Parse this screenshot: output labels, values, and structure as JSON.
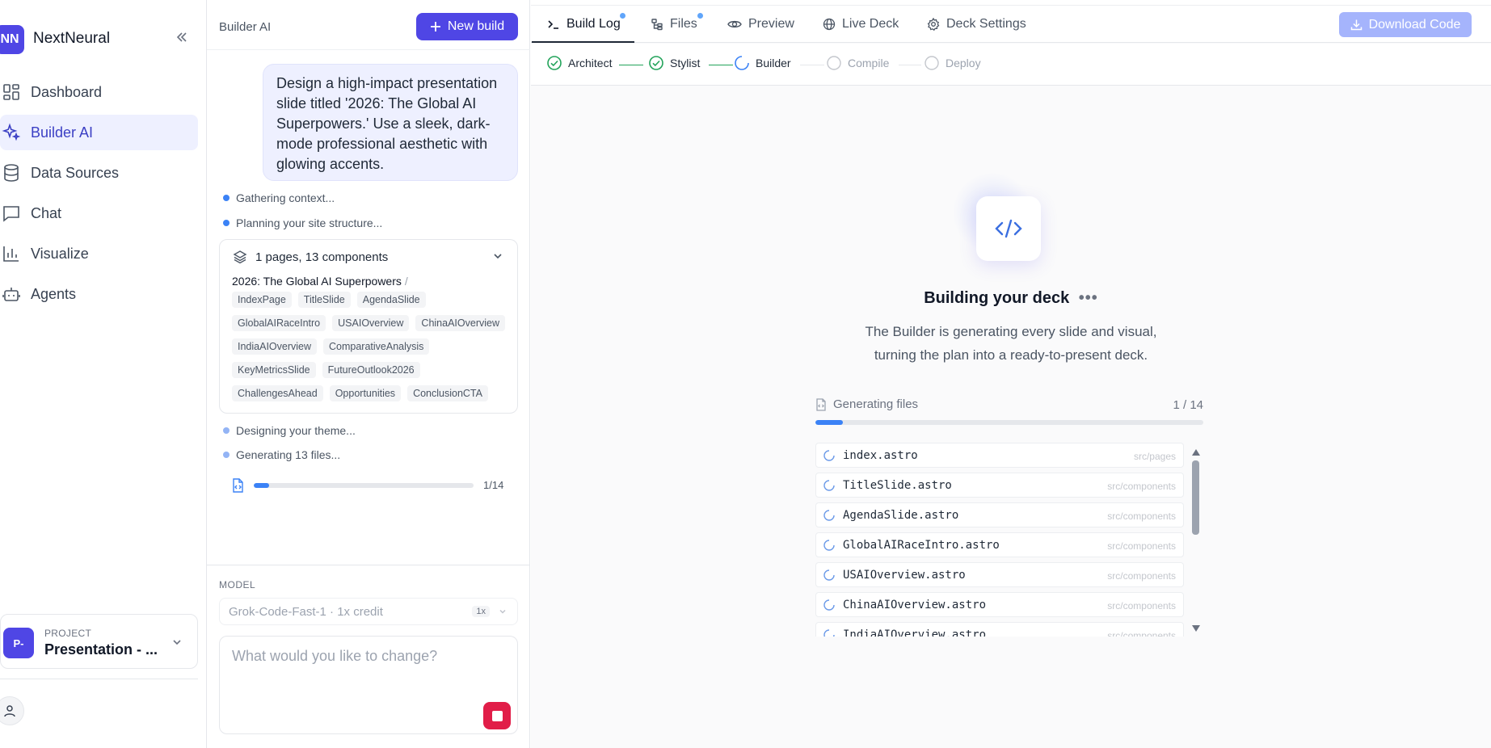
{
  "nav": {
    "logo": "NN",
    "brand": "NextNeural",
    "items": [
      {
        "label": "Dashboard",
        "icon": "dashboard-icon"
      },
      {
        "label": "Builder AI",
        "icon": "sparkles-icon",
        "active": true
      },
      {
        "label": "Data Sources",
        "icon": "database-icon"
      },
      {
        "label": "Chat",
        "icon": "chat-icon"
      },
      {
        "label": "Visualize",
        "icon": "bar-chart-icon"
      },
      {
        "label": "Agents",
        "icon": "bot-icon"
      }
    ],
    "project": {
      "avatar": "P-",
      "label": "PROJECT",
      "name": "Presentation - ..."
    }
  },
  "builder": {
    "title": "Builder AI",
    "new_build_label": "New build",
    "message": "Design a high-impact presentation slide titled '2026: The Global AI Superpowers.' Use a sleek, dark-mode professional aesthetic with glowing accents.",
    "steps": [
      "Gathering context...",
      "Planning your site structure...",
      "Designing your theme...",
      "Generating 13 files..."
    ],
    "structure": {
      "summary": "1 pages, 13 components",
      "page": "2026: The Global AI Superpowers",
      "separator": "/",
      "components": [
        "IndexPage",
        "TitleSlide",
        "AgendaSlide",
        "GlobalAIRaceIntro",
        "USAIOverview",
        "ChinaAIOverview",
        "IndiaAIOverview",
        "ComparativeAnalysis",
        "KeyMetricsSlide",
        "FutureOutlook2026",
        "ChallengesAhead",
        "Opportunities",
        "ConclusionCTA"
      ]
    },
    "progress": {
      "count": "1/14",
      "fraction": 0.0714
    },
    "model_label": "MODEL",
    "model_value": "Grok-Code-Fast-1 · 1x credit",
    "model_badge": "1x",
    "prompt_placeholder": "What would you like to change?"
  },
  "main": {
    "tabs": [
      {
        "label": "Build Log",
        "icon": "terminal-icon",
        "active": true,
        "dot": true
      },
      {
        "label": "Files",
        "icon": "file-tree-icon",
        "dot": true
      },
      {
        "label": "Preview",
        "icon": "eye-icon"
      },
      {
        "label": "Live Deck",
        "icon": "globe-icon"
      },
      {
        "label": "Deck Settings",
        "icon": "gear-icon"
      }
    ],
    "download_label": "Download Code",
    "pipeline": [
      {
        "label": "Architect",
        "status": "done"
      },
      {
        "label": "Stylist",
        "status": "done"
      },
      {
        "label": "Builder",
        "status": "active"
      },
      {
        "label": "Compile",
        "status": "pending"
      },
      {
        "label": "Deploy",
        "status": "pending"
      }
    ],
    "building_title": "Building your deck",
    "building_sub": "The Builder is generating every slide and visual, turning the plan into a ready-to-present deck.",
    "generating_label": "Generating files",
    "generating_count": "1 / 14",
    "generating_fraction": 0.0714,
    "files": [
      {
        "name": "index.astro",
        "path": "src/pages"
      },
      {
        "name": "TitleSlide.astro",
        "path": "src/components"
      },
      {
        "name": "AgendaSlide.astro",
        "path": "src/components"
      },
      {
        "name": "GlobalAIRaceIntro.astro",
        "path": "src/components"
      },
      {
        "name": "USAIOverview.astro",
        "path": "src/components"
      },
      {
        "name": "ChinaAIOverview.astro",
        "path": "src/components"
      },
      {
        "name": "IndiaAIOverview.astro",
        "path": "src/components"
      }
    ]
  },
  "colors": {
    "accent": "#4f46e5",
    "progress": "#3b82f6",
    "done": "#22a35a",
    "stop": "#e11d48",
    "download_disabled": "#a5b4fc"
  }
}
